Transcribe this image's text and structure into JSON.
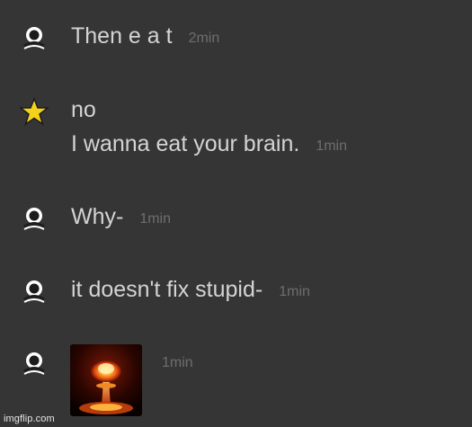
{
  "messages": [
    {
      "user_icon": "user-icon",
      "lines": [
        "Then e a t"
      ],
      "time": "2min"
    },
    {
      "user_icon": "star-icon",
      "star_color": "#f2d21b",
      "lines": [
        "no",
        "I wanna eat your brain."
      ],
      "time": "1min"
    },
    {
      "user_icon": "user-icon",
      "lines": [
        "Why-"
      ],
      "time": "1min"
    },
    {
      "user_icon": "user-icon",
      "lines": [
        "it doesn't fix stupid-"
      ],
      "time": "1min"
    },
    {
      "user_icon": "user-icon",
      "image": "nuclear-explosion-image",
      "time": "1min"
    }
  ],
  "watermark": "imgflip.com",
  "colors": {
    "background": "#353535",
    "text": "#d4d4d4",
    "timestamp": "#6e6e6e"
  }
}
